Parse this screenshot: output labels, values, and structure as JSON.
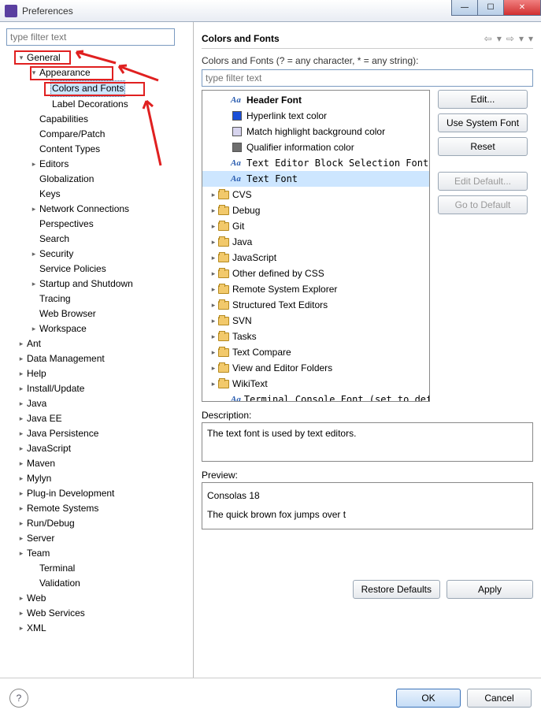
{
  "window": {
    "title": "Preferences"
  },
  "left": {
    "filter_placeholder": "type filter text",
    "tree": [
      {
        "label": "General",
        "level": 1,
        "caret": "open"
      },
      {
        "label": "Appearance",
        "level": 2,
        "caret": "open"
      },
      {
        "label": "Colors and Fonts",
        "level": 3,
        "caret": "none",
        "selected": true
      },
      {
        "label": "Label Decorations",
        "level": 3,
        "caret": "none"
      },
      {
        "label": "Capabilities",
        "level": 2,
        "caret": "none"
      },
      {
        "label": "Compare/Patch",
        "level": 2,
        "caret": "none"
      },
      {
        "label": "Content Types",
        "level": 2,
        "caret": "none"
      },
      {
        "label": "Editors",
        "level": 2,
        "caret": "closed"
      },
      {
        "label": "Globalization",
        "level": 2,
        "caret": "none"
      },
      {
        "label": "Keys",
        "level": 2,
        "caret": "none"
      },
      {
        "label": "Network Connections",
        "level": 2,
        "caret": "closed"
      },
      {
        "label": "Perspectives",
        "level": 2,
        "caret": "none"
      },
      {
        "label": "Search",
        "level": 2,
        "caret": "none"
      },
      {
        "label": "Security",
        "level": 2,
        "caret": "closed"
      },
      {
        "label": "Service Policies",
        "level": 2,
        "caret": "none"
      },
      {
        "label": "Startup and Shutdown",
        "level": 2,
        "caret": "closed"
      },
      {
        "label": "Tracing",
        "level": 2,
        "caret": "none"
      },
      {
        "label": "Web Browser",
        "level": 2,
        "caret": "none"
      },
      {
        "label": "Workspace",
        "level": 2,
        "caret": "closed"
      },
      {
        "label": "Ant",
        "level": 1,
        "caret": "closed"
      },
      {
        "label": "Data Management",
        "level": 1,
        "caret": "closed"
      },
      {
        "label": "Help",
        "level": 1,
        "caret": "closed"
      },
      {
        "label": "Install/Update",
        "level": 1,
        "caret": "closed"
      },
      {
        "label": "Java",
        "level": 1,
        "caret": "closed"
      },
      {
        "label": "Java EE",
        "level": 1,
        "caret": "closed"
      },
      {
        "label": "Java Persistence",
        "level": 1,
        "caret": "closed"
      },
      {
        "label": "JavaScript",
        "level": 1,
        "caret": "closed"
      },
      {
        "label": "Maven",
        "level": 1,
        "caret": "closed"
      },
      {
        "label": "Mylyn",
        "level": 1,
        "caret": "closed"
      },
      {
        "label": "Plug-in Development",
        "level": 1,
        "caret": "closed"
      },
      {
        "label": "Remote Systems",
        "level": 1,
        "caret": "closed"
      },
      {
        "label": "Run/Debug",
        "level": 1,
        "caret": "closed"
      },
      {
        "label": "Server",
        "level": 1,
        "caret": "closed"
      },
      {
        "label": "Team",
        "level": 1,
        "caret": "closed"
      },
      {
        "label": "Terminal",
        "level": 2,
        "caret": "none"
      },
      {
        "label": "Validation",
        "level": 2,
        "caret": "none"
      },
      {
        "label": "Web",
        "level": 1,
        "caret": "closed"
      },
      {
        "label": "Web Services",
        "level": 1,
        "caret": "closed"
      },
      {
        "label": "XML",
        "level": 1,
        "caret": "closed"
      }
    ]
  },
  "right": {
    "title": "Colors and Fonts",
    "hint": "Colors and Fonts (? = any character, * = any string):",
    "filter_placeholder": "type filter text",
    "tree": [
      {
        "icon": "aa",
        "label": "Header Font",
        "bold": true,
        "indent": 2
      },
      {
        "icon": "sq",
        "color": "#1a4fd8",
        "label": "Hyperlink text color",
        "indent": 2
      },
      {
        "icon": "sq",
        "color": "#d7d4ee",
        "label": "Match highlight background color",
        "indent": 2
      },
      {
        "icon": "sq",
        "color": "#6e6e6e",
        "label": "Qualifier information color",
        "indent": 2
      },
      {
        "icon": "aa",
        "label": "Text Editor Block Selection Font",
        "mono": true,
        "indent": 2
      },
      {
        "icon": "aa",
        "label": "Text Font",
        "mono": true,
        "indent": 2,
        "selected": true
      },
      {
        "icon": "folder",
        "label": "CVS",
        "caret": "closed",
        "indent": 1
      },
      {
        "icon": "folder",
        "label": "Debug",
        "caret": "closed",
        "indent": 1
      },
      {
        "icon": "folder",
        "label": "Git",
        "caret": "closed",
        "indent": 1
      },
      {
        "icon": "folder",
        "label": "Java",
        "caret": "closed",
        "indent": 1
      },
      {
        "icon": "folder",
        "label": "JavaScript",
        "caret": "closed",
        "indent": 1
      },
      {
        "icon": "folder",
        "label": "Other defined by CSS",
        "caret": "closed",
        "indent": 1
      },
      {
        "icon": "folder",
        "label": "Remote System Explorer",
        "caret": "closed",
        "indent": 1
      },
      {
        "icon": "folder",
        "label": "Structured Text Editors",
        "caret": "closed",
        "indent": 1
      },
      {
        "icon": "folder",
        "label": "SVN",
        "caret": "closed",
        "indent": 1
      },
      {
        "icon": "folder",
        "label": "Tasks",
        "caret": "closed",
        "indent": 1
      },
      {
        "icon": "folder",
        "label": "Text Compare",
        "caret": "closed",
        "indent": 1
      },
      {
        "icon": "folder",
        "label": "View and Editor Folders",
        "caret": "closed",
        "indent": 1
      },
      {
        "icon": "folder",
        "label": "WikiText",
        "caret": "closed",
        "indent": 1
      },
      {
        "icon": "aa",
        "label": "Terminal Console Font (set to default",
        "mono": true,
        "indent": 2
      }
    ],
    "buttons": {
      "edit": "Edit...",
      "use_system": "Use System Font",
      "reset": "Reset",
      "edit_default": "Edit Default...",
      "go_default": "Go to Default"
    },
    "desc_label": "Description:",
    "desc_text": "The text font is used by text editors.",
    "preview_label": "Preview:",
    "preview_line1": "Consolas 18",
    "preview_line2": "The quick brown fox jumps over t",
    "restore": "Restore Defaults",
    "apply": "Apply"
  },
  "footer": {
    "ok": "OK",
    "cancel": "Cancel"
  }
}
